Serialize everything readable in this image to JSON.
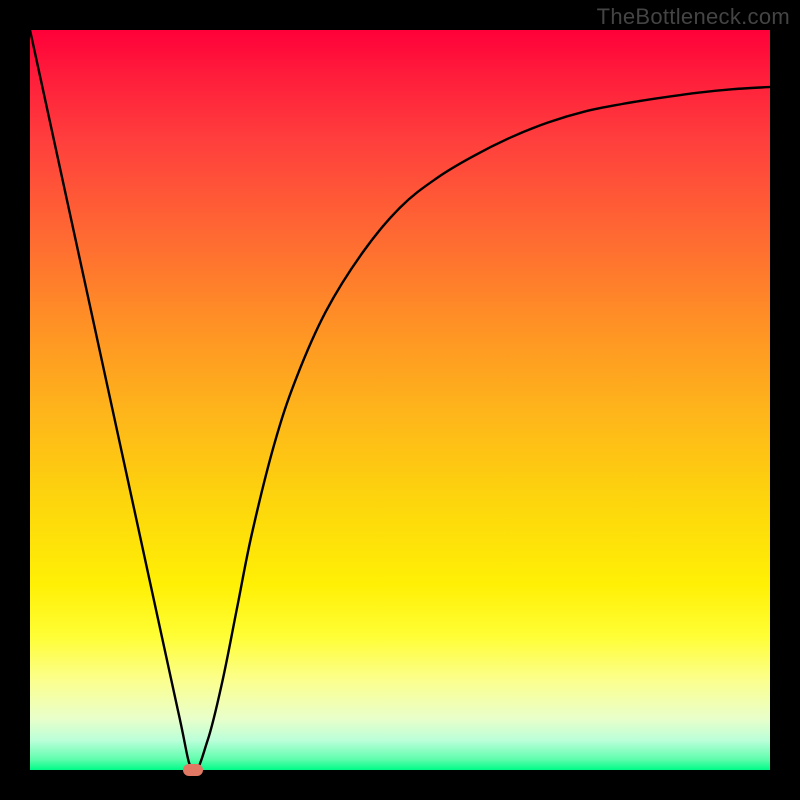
{
  "watermark": "TheBottleneck.com",
  "chart_data": {
    "type": "line",
    "title": "",
    "xlabel": "",
    "ylabel": "",
    "xlim": [
      0,
      100
    ],
    "ylim": [
      0,
      100
    ],
    "series": [
      {
        "name": "bottleneck-curve",
        "x": [
          0,
          5,
          10,
          15,
          20,
          22,
          24,
          26,
          28,
          30,
          33,
          36,
          40,
          45,
          50,
          55,
          60,
          65,
          70,
          75,
          80,
          85,
          90,
          95,
          100
        ],
        "values": [
          100,
          77,
          54,
          31,
          8,
          0,
          4,
          12,
          22,
          32,
          44,
          53,
          62,
          70,
          76,
          80,
          83,
          85.5,
          87.5,
          89,
          90,
          90.8,
          91.5,
          92,
          92.3
        ]
      }
    ],
    "annotations": [
      {
        "name": "min-point-marker",
        "x": 22,
        "y": 0,
        "color": "#e17864"
      }
    ],
    "background_gradient": {
      "top": "#ff0039",
      "mid": "#fdd60c",
      "bottom": "#00fb88"
    }
  }
}
